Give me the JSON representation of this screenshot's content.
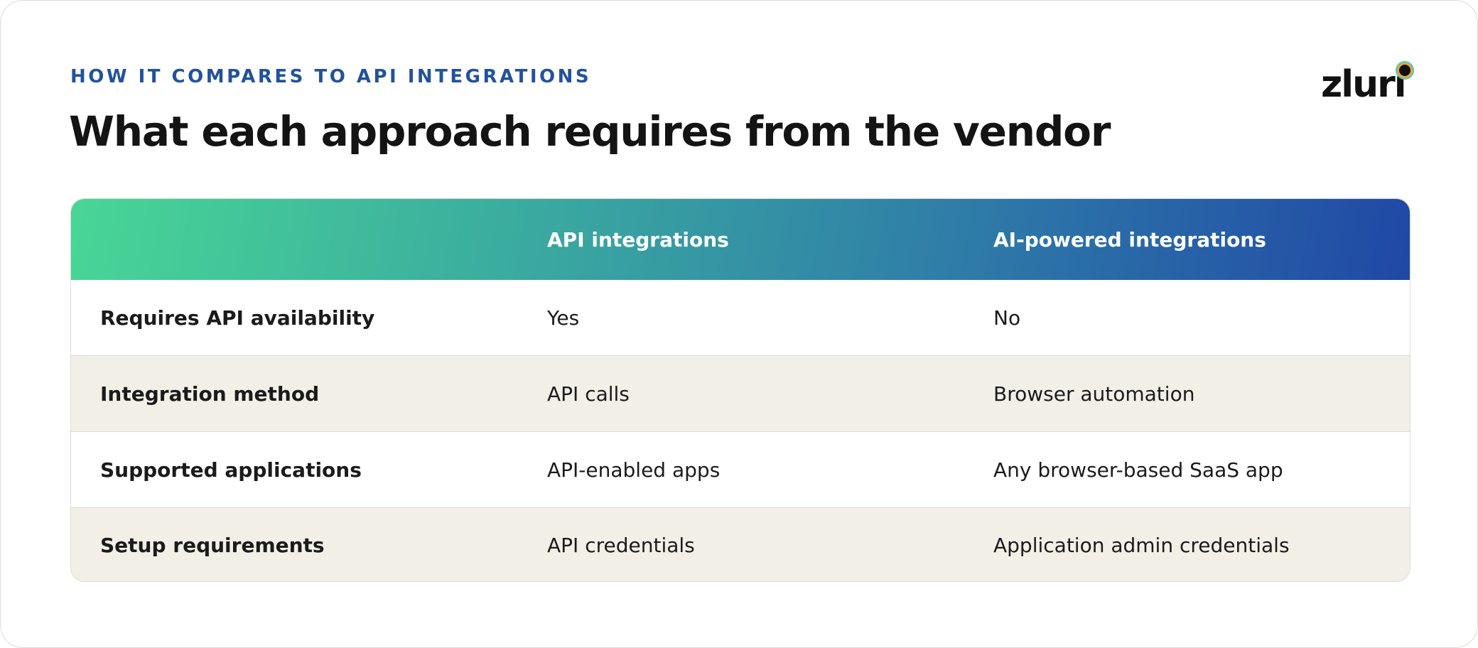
{
  "header": {
    "eyebrow": "HOW IT COMPARES TO API INTEGRATIONS",
    "title": "What each approach requires from the vendor"
  },
  "logo": {
    "text": "zluri",
    "colors": {
      "text": "#111111",
      "dot_ring_outer": "#3fd0b0",
      "dot_ring_inner": "#f6a13a"
    }
  },
  "table": {
    "columns": [
      "",
      "API integrations",
      "AI-powered integrations"
    ],
    "rows": [
      {
        "label": "Requires API availability",
        "api": "Yes",
        "ai": "No"
      },
      {
        "label": "Integration method",
        "api": "API calls",
        "ai": "Browser automation"
      },
      {
        "label": "Supported applications",
        "api": "API-enabled apps",
        "ai": "Any browser-based SaaS app"
      },
      {
        "label": "Setup requirements",
        "api": "API credentials",
        "ai": "Application admin credentials"
      }
    ]
  },
  "colors": {
    "accent": "#22529c",
    "header_gradient_start": "#48d696",
    "header_gradient_end": "#2048a6",
    "row_alt": "#f2efe7"
  }
}
